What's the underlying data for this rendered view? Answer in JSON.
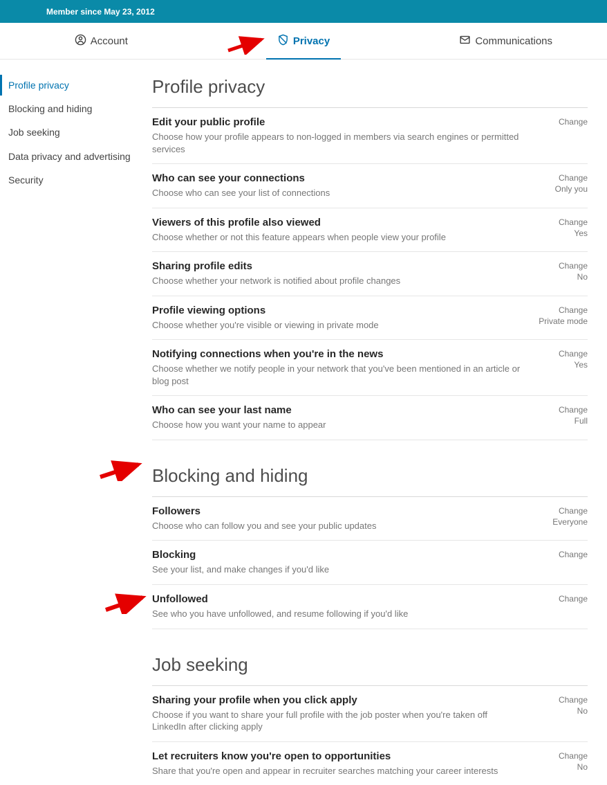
{
  "header": {
    "member_since": "Member since May 23, 2012"
  },
  "tabs": {
    "account": "Account",
    "privacy": "Privacy",
    "communications": "Communications"
  },
  "sidebar": {
    "items": [
      {
        "label": "Profile privacy"
      },
      {
        "label": "Blocking and hiding"
      },
      {
        "label": "Job seeking"
      },
      {
        "label": "Data privacy and advertising"
      },
      {
        "label": "Security"
      }
    ]
  },
  "sections": {
    "profile_privacy": {
      "title": "Profile privacy",
      "rows": [
        {
          "title": "Edit your public profile",
          "desc": "Choose how your profile appears to non-logged in members via search engines or permitted services",
          "change": "Change",
          "value": ""
        },
        {
          "title": "Who can see your connections",
          "desc": "Choose who can see your list of connections",
          "change": "Change",
          "value": "Only you"
        },
        {
          "title": "Viewers of this profile also viewed",
          "desc": "Choose whether or not this feature appears when people view your profile",
          "change": "Change",
          "value": "Yes"
        },
        {
          "title": "Sharing profile edits",
          "desc": "Choose whether your network is notified about profile changes",
          "change": "Change",
          "value": "No"
        },
        {
          "title": "Profile viewing options",
          "desc": "Choose whether you're visible or viewing in private mode",
          "change": "Change",
          "value": "Private mode"
        },
        {
          "title": "Notifying connections when you're in the news",
          "desc": "Choose whether we notify people in your network that you've been mentioned in an article or blog post",
          "change": "Change",
          "value": "Yes"
        },
        {
          "title": "Who can see your last name",
          "desc": "Choose how you want your name to appear",
          "change": "Change",
          "value": "Full"
        }
      ]
    },
    "blocking_hiding": {
      "title": "Blocking and hiding",
      "rows": [
        {
          "title": "Followers",
          "desc": "Choose who can follow you and see your public updates",
          "change": "Change",
          "value": "Everyone"
        },
        {
          "title": "Blocking",
          "desc": "See your list, and make changes if you'd like",
          "change": "Change",
          "value": ""
        },
        {
          "title": "Unfollowed",
          "desc": "See who you have unfollowed, and resume following if you'd like",
          "change": "Change",
          "value": ""
        }
      ]
    },
    "job_seeking": {
      "title": "Job seeking",
      "rows": [
        {
          "title": "Sharing your profile when you click apply",
          "desc": "Choose if you want to share your full profile with the job poster when you're taken off LinkedIn after clicking apply",
          "change": "Change",
          "value": "No"
        },
        {
          "title": "Let recruiters know you're open to opportunities",
          "desc": "Share that you're open and appear in recruiter searches matching your career interests",
          "change": "Change",
          "value": "No"
        }
      ]
    }
  }
}
